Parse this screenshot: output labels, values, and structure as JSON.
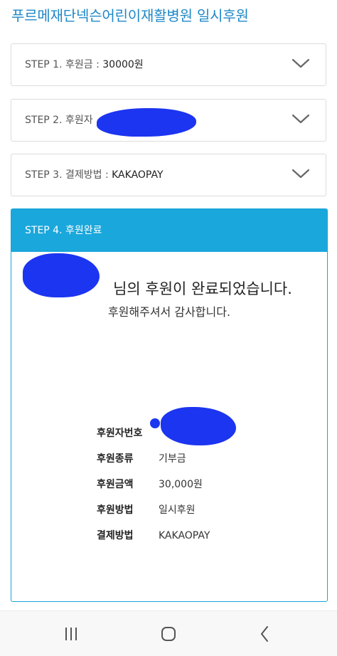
{
  "header": {
    "title": "푸르메재단넥슨어린이재활병원 일시후원"
  },
  "steps": [
    {
      "label": "STEP 1. 후원금 : ",
      "value": "30000원"
    },
    {
      "label": "STEP 2. 후원자",
      "value": ""
    },
    {
      "label": "STEP 3. 결제방법 : ",
      "value": "KAKAOPAY"
    }
  ],
  "step4": {
    "label": "STEP 4. 후원완료",
    "message": "님의 후원이 완료되었습니다.",
    "thanks": "후원해주셔서 감사합니다.",
    "info": [
      {
        "label": "후원자번호",
        "value": ""
      },
      {
        "label": "후원종류",
        "value": "기부금"
      },
      {
        "label": "후원금액",
        "value": "30,000원"
      },
      {
        "label": "후원방법",
        "value": "일시후원"
      },
      {
        "label": "결제방법",
        "value": "KAKAOPAY"
      }
    ]
  },
  "navbar": {
    "icons": [
      "recent-apps-icon",
      "home-icon",
      "back-icon"
    ]
  },
  "colors": {
    "accent": "#19a7dc",
    "title": "#1e88c8",
    "redaction": "#1c35f0"
  }
}
